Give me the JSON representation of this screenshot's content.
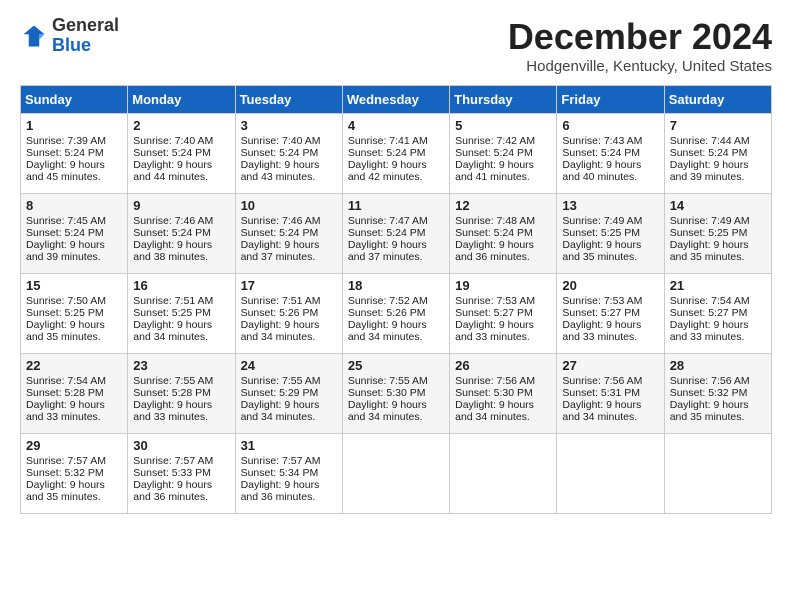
{
  "header": {
    "logo_line1": "General",
    "logo_line2": "Blue",
    "month": "December 2024",
    "location": "Hodgenville, Kentucky, United States"
  },
  "days_of_week": [
    "Sunday",
    "Monday",
    "Tuesday",
    "Wednesday",
    "Thursday",
    "Friday",
    "Saturday"
  ],
  "weeks": [
    [
      {
        "day": "1",
        "sunrise": "Sunrise: 7:39 AM",
        "sunset": "Sunset: 5:24 PM",
        "daylight": "Daylight: 9 hours and 45 minutes."
      },
      {
        "day": "2",
        "sunrise": "Sunrise: 7:40 AM",
        "sunset": "Sunset: 5:24 PM",
        "daylight": "Daylight: 9 hours and 44 minutes."
      },
      {
        "day": "3",
        "sunrise": "Sunrise: 7:40 AM",
        "sunset": "Sunset: 5:24 PM",
        "daylight": "Daylight: 9 hours and 43 minutes."
      },
      {
        "day": "4",
        "sunrise": "Sunrise: 7:41 AM",
        "sunset": "Sunset: 5:24 PM",
        "daylight": "Daylight: 9 hours and 42 minutes."
      },
      {
        "day": "5",
        "sunrise": "Sunrise: 7:42 AM",
        "sunset": "Sunset: 5:24 PM",
        "daylight": "Daylight: 9 hours and 41 minutes."
      },
      {
        "day": "6",
        "sunrise": "Sunrise: 7:43 AM",
        "sunset": "Sunset: 5:24 PM",
        "daylight": "Daylight: 9 hours and 40 minutes."
      },
      {
        "day": "7",
        "sunrise": "Sunrise: 7:44 AM",
        "sunset": "Sunset: 5:24 PM",
        "daylight": "Daylight: 9 hours and 39 minutes."
      }
    ],
    [
      {
        "day": "8",
        "sunrise": "Sunrise: 7:45 AM",
        "sunset": "Sunset: 5:24 PM",
        "daylight": "Daylight: 9 hours and 39 minutes."
      },
      {
        "day": "9",
        "sunrise": "Sunrise: 7:46 AM",
        "sunset": "Sunset: 5:24 PM",
        "daylight": "Daylight: 9 hours and 38 minutes."
      },
      {
        "day": "10",
        "sunrise": "Sunrise: 7:46 AM",
        "sunset": "Sunset: 5:24 PM",
        "daylight": "Daylight: 9 hours and 37 minutes."
      },
      {
        "day": "11",
        "sunrise": "Sunrise: 7:47 AM",
        "sunset": "Sunset: 5:24 PM",
        "daylight": "Daylight: 9 hours and 37 minutes."
      },
      {
        "day": "12",
        "sunrise": "Sunrise: 7:48 AM",
        "sunset": "Sunset: 5:24 PM",
        "daylight": "Daylight: 9 hours and 36 minutes."
      },
      {
        "day": "13",
        "sunrise": "Sunrise: 7:49 AM",
        "sunset": "Sunset: 5:25 PM",
        "daylight": "Daylight: 9 hours and 35 minutes."
      },
      {
        "day": "14",
        "sunrise": "Sunrise: 7:49 AM",
        "sunset": "Sunset: 5:25 PM",
        "daylight": "Daylight: 9 hours and 35 minutes."
      }
    ],
    [
      {
        "day": "15",
        "sunrise": "Sunrise: 7:50 AM",
        "sunset": "Sunset: 5:25 PM",
        "daylight": "Daylight: 9 hours and 35 minutes."
      },
      {
        "day": "16",
        "sunrise": "Sunrise: 7:51 AM",
        "sunset": "Sunset: 5:25 PM",
        "daylight": "Daylight: 9 hours and 34 minutes."
      },
      {
        "day": "17",
        "sunrise": "Sunrise: 7:51 AM",
        "sunset": "Sunset: 5:26 PM",
        "daylight": "Daylight: 9 hours and 34 minutes."
      },
      {
        "day": "18",
        "sunrise": "Sunrise: 7:52 AM",
        "sunset": "Sunset: 5:26 PM",
        "daylight": "Daylight: 9 hours and 34 minutes."
      },
      {
        "day": "19",
        "sunrise": "Sunrise: 7:53 AM",
        "sunset": "Sunset: 5:27 PM",
        "daylight": "Daylight: 9 hours and 33 minutes."
      },
      {
        "day": "20",
        "sunrise": "Sunrise: 7:53 AM",
        "sunset": "Sunset: 5:27 PM",
        "daylight": "Daylight: 9 hours and 33 minutes."
      },
      {
        "day": "21",
        "sunrise": "Sunrise: 7:54 AM",
        "sunset": "Sunset: 5:27 PM",
        "daylight": "Daylight: 9 hours and 33 minutes."
      }
    ],
    [
      {
        "day": "22",
        "sunrise": "Sunrise: 7:54 AM",
        "sunset": "Sunset: 5:28 PM",
        "daylight": "Daylight: 9 hours and 33 minutes."
      },
      {
        "day": "23",
        "sunrise": "Sunrise: 7:55 AM",
        "sunset": "Sunset: 5:28 PM",
        "daylight": "Daylight: 9 hours and 33 minutes."
      },
      {
        "day": "24",
        "sunrise": "Sunrise: 7:55 AM",
        "sunset": "Sunset: 5:29 PM",
        "daylight": "Daylight: 9 hours and 34 minutes."
      },
      {
        "day": "25",
        "sunrise": "Sunrise: 7:55 AM",
        "sunset": "Sunset: 5:30 PM",
        "daylight": "Daylight: 9 hours and 34 minutes."
      },
      {
        "day": "26",
        "sunrise": "Sunrise: 7:56 AM",
        "sunset": "Sunset: 5:30 PM",
        "daylight": "Daylight: 9 hours and 34 minutes."
      },
      {
        "day": "27",
        "sunrise": "Sunrise: 7:56 AM",
        "sunset": "Sunset: 5:31 PM",
        "daylight": "Daylight: 9 hours and 34 minutes."
      },
      {
        "day": "28",
        "sunrise": "Sunrise: 7:56 AM",
        "sunset": "Sunset: 5:32 PM",
        "daylight": "Daylight: 9 hours and 35 minutes."
      }
    ],
    [
      {
        "day": "29",
        "sunrise": "Sunrise: 7:57 AM",
        "sunset": "Sunset: 5:32 PM",
        "daylight": "Daylight: 9 hours and 35 minutes."
      },
      {
        "day": "30",
        "sunrise": "Sunrise: 7:57 AM",
        "sunset": "Sunset: 5:33 PM",
        "daylight": "Daylight: 9 hours and 36 minutes."
      },
      {
        "day": "31",
        "sunrise": "Sunrise: 7:57 AM",
        "sunset": "Sunset: 5:34 PM",
        "daylight": "Daylight: 9 hours and 36 minutes."
      },
      null,
      null,
      null,
      null
    ]
  ]
}
